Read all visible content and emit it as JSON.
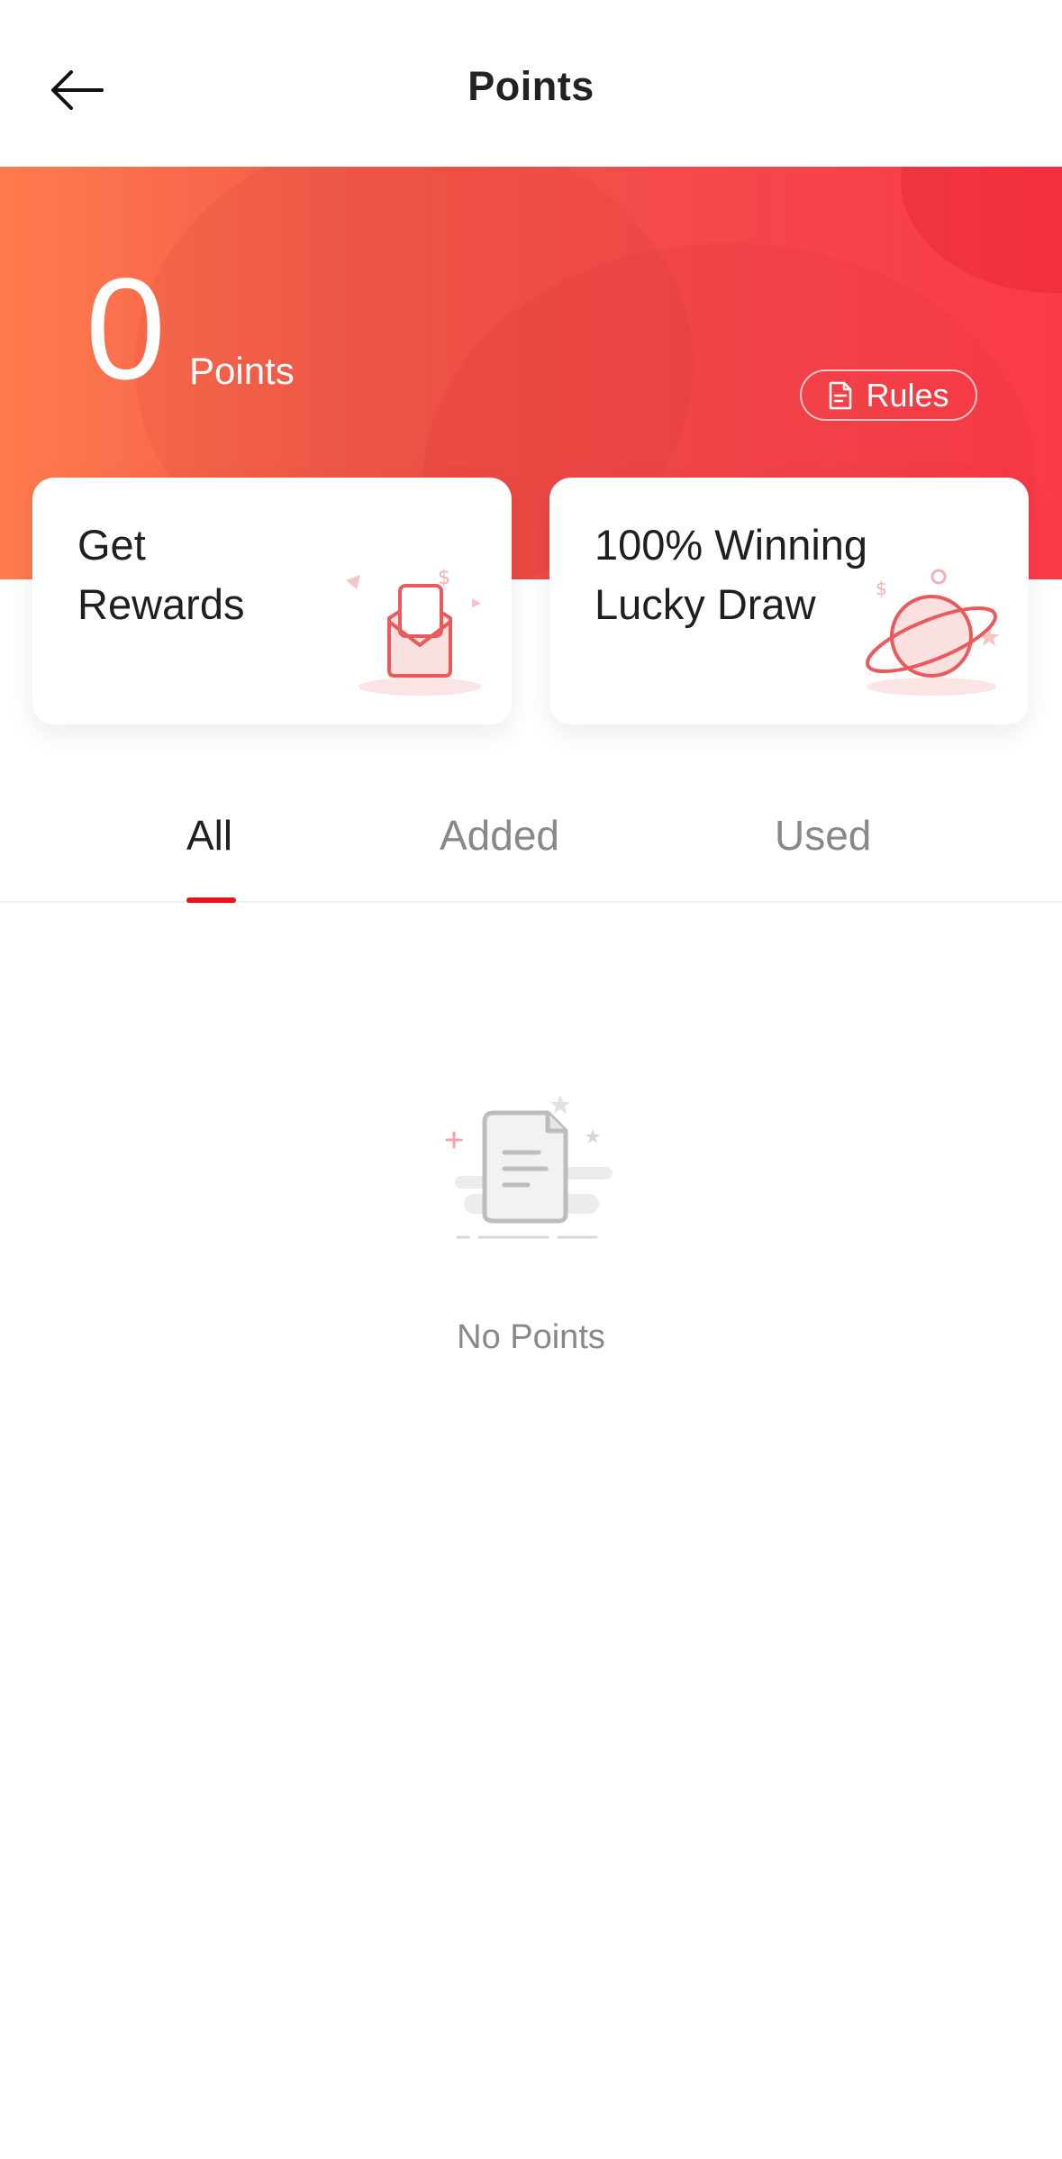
{
  "header": {
    "title": "Points",
    "back_icon": "arrow-left-icon"
  },
  "hero": {
    "points_value": "0",
    "points_label": "Points",
    "rules_label": "Rules",
    "rules_icon": "document-icon"
  },
  "cards": [
    {
      "title": "Get\nRewards",
      "icon": "envelope-icon"
    },
    {
      "title": "100% Winning\nLucky Draw",
      "icon": "planet-icon"
    }
  ],
  "tabs": [
    {
      "label": "All",
      "active": true
    },
    {
      "label": "Added",
      "active": false
    },
    {
      "label": "Used",
      "active": false
    }
  ],
  "empty_state": {
    "text": "No Points",
    "icon": "empty-document-icon"
  },
  "colors": {
    "accent": "#e8131e",
    "hero_start": "#ff7b4e",
    "hero_end": "#fb3a48"
  }
}
